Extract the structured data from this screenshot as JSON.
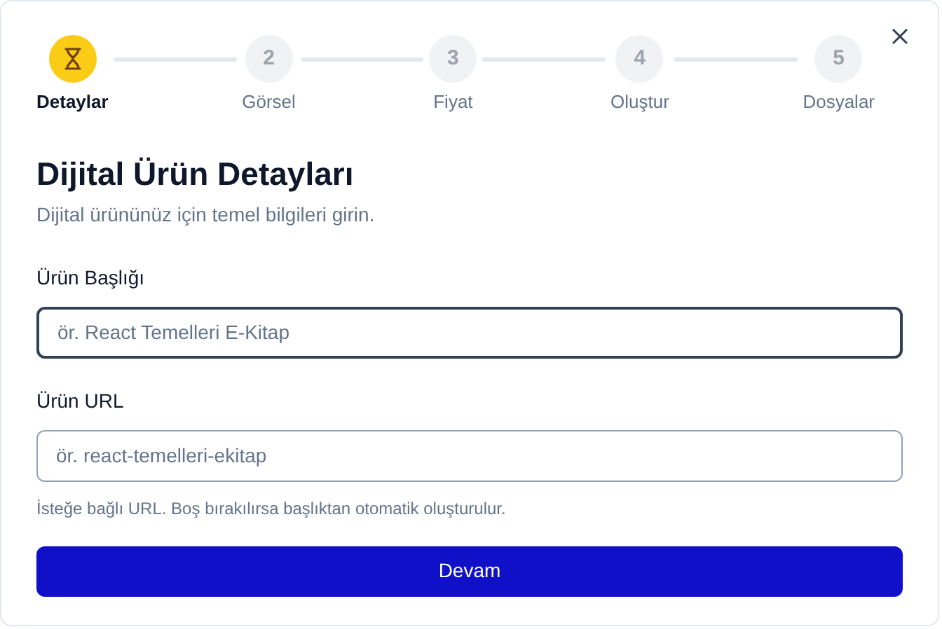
{
  "steps": [
    {
      "label": "Detaylar",
      "selected": true
    },
    {
      "number": "2",
      "label": "Görsel",
      "selected": false
    },
    {
      "number": "3",
      "label": "Fiyat",
      "selected": false
    },
    {
      "number": "4",
      "label": "Oluştur",
      "selected": false
    },
    {
      "number": "5",
      "label": "Dosyalar",
      "selected": false
    }
  ],
  "title": "Dijital Ürün Detayları",
  "subtitle": "Dijital ürününüz için temel bilgileri girin.",
  "fields": [
    {
      "label": "Ürün Başlığı",
      "placeholder": "ör. React Temelleri E-Kitap",
      "focused": true
    },
    {
      "label": "Ürün URL",
      "placeholder": "ör. react-temelleri-ekitap",
      "focused": false,
      "help": "İsteğe bağlı URL. Boş bırakılırsa başlıktan otomatik oluşturulur."
    }
  ],
  "submit": "Devam"
}
